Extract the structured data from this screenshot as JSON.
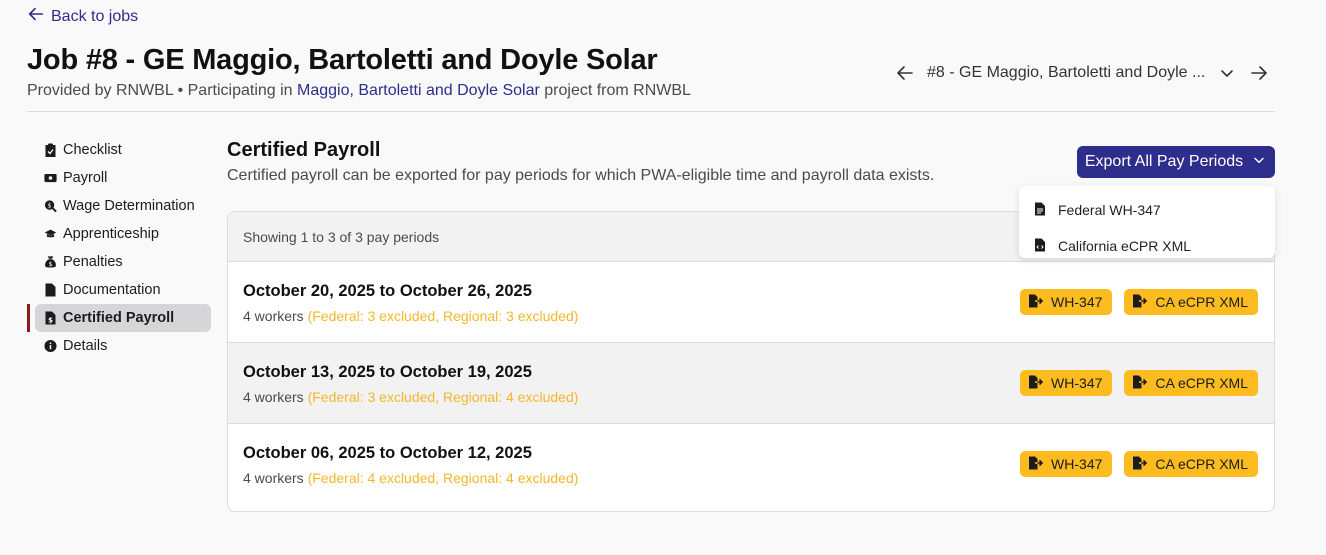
{
  "back_link": {
    "label": "Back to jobs"
  },
  "job": {
    "title": "Job #8 - GE Maggio, Bartoletti and Doyle Solar",
    "provided_prefix": "Provided by RNWBL • Participating in ",
    "project_link": "Maggio, Bartoletti and Doyle Solar",
    "provided_suffix": " project from RNWBL"
  },
  "job_nav": {
    "selected": "#8 - GE Maggio, Bartoletti and Doyle ..."
  },
  "sidebar": {
    "items": [
      {
        "label": "Checklist",
        "icon": "clipboard-check-icon"
      },
      {
        "label": "Payroll",
        "icon": "money-bill-icon"
      },
      {
        "label": "Wage Determination",
        "icon": "search-dollar-icon"
      },
      {
        "label": "Apprenticeship",
        "icon": "graduation-cap-icon"
      },
      {
        "label": "Penalties",
        "icon": "money-bag-icon"
      },
      {
        "label": "Documentation",
        "icon": "file-icon"
      },
      {
        "label": "Certified Payroll",
        "icon": "file-invoice-dollar-icon",
        "active": true
      },
      {
        "label": "Details",
        "icon": "info-circle-icon"
      }
    ]
  },
  "section": {
    "title": "Certified Payroll",
    "description": "Certified payroll can be exported for pay periods for which PWA-eligible time and payroll data exists."
  },
  "export": {
    "label": "Export All Pay Periods",
    "options": [
      "Federal WH-347",
      "California eCPR XML"
    ]
  },
  "table": {
    "summary": "Showing 1 to 3 of 3 pay periods",
    "rows": [
      {
        "period": "October 20, 2025 to October 26, 2025",
        "workers": "4 workers",
        "excluded": "(Federal: 3 excluded, Regional: 3 excluded)"
      },
      {
        "period": "October 13, 2025 to October 19, 2025",
        "workers": "4 workers",
        "excluded": "(Federal: 3 excluded, Regional: 4 excluded)"
      },
      {
        "period": "October 06, 2025 to October 12, 2025",
        "workers": "4 workers",
        "excluded": "(Federal: 4 excluded, Regional: 4 excluded)"
      }
    ],
    "actions": {
      "wh347": "WH-347",
      "ecpr": "CA eCPR XML"
    }
  },
  "colors": {
    "accent": "#2d2d8c",
    "active_marker": "#8c1c1c",
    "pill": "#fcbc1f",
    "excluded": "#f3b82a"
  }
}
